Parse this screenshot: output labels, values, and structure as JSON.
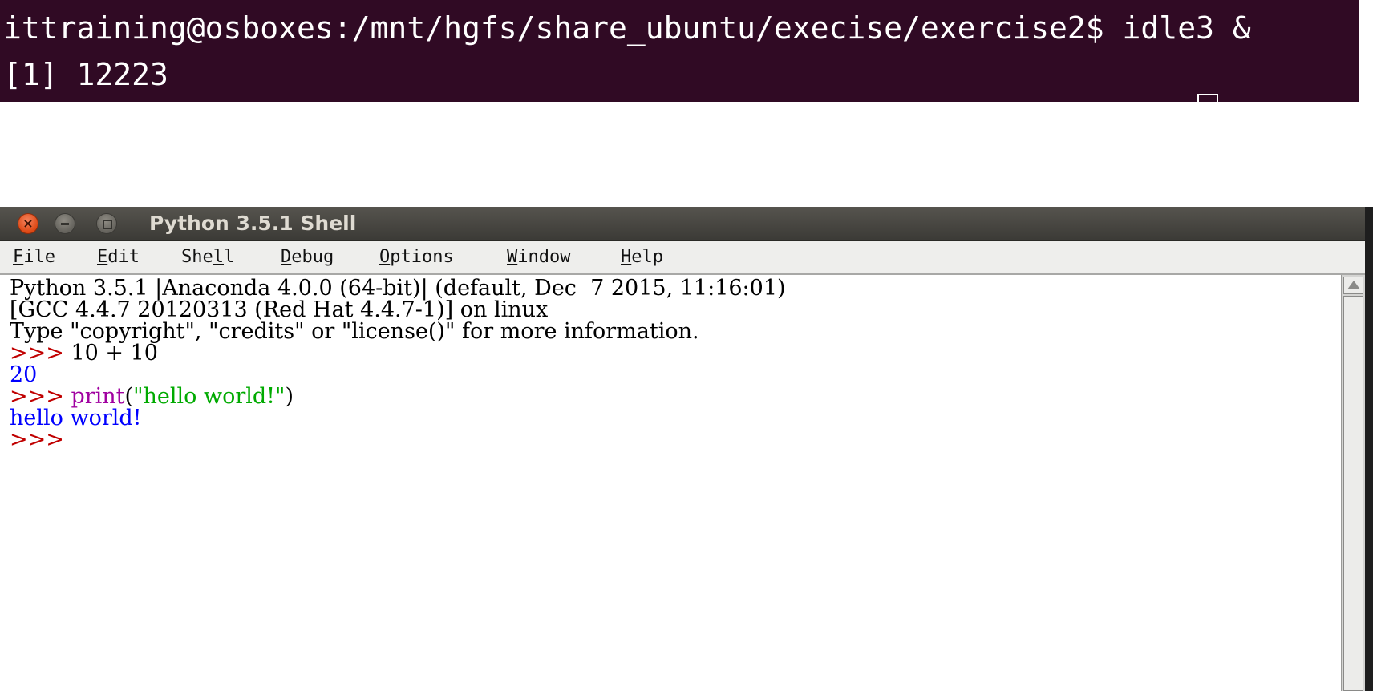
{
  "terminal": {
    "lines": [
      "ittraining@osboxes:/mnt/hgfs/share_ubuntu/execise/exercise2$ idle3 &",
      "[1] 12223"
    ],
    "background": "#300a24"
  },
  "window": {
    "title": "Python 3.5.1 Shell",
    "close_glyph": "×",
    "menu": [
      {
        "key": "F",
        "rest": "ile"
      },
      {
        "key": "E",
        "rest": "dit"
      },
      {
        "pre": "She",
        "key": "l",
        "rest": "l"
      },
      {
        "key": "D",
        "rest": "ebug"
      },
      {
        "key": "O",
        "rest": "ptions"
      },
      {
        "key": "W",
        "rest": "indow"
      },
      {
        "key": "H",
        "rest": "elp"
      }
    ]
  },
  "shell": {
    "banner": [
      "Python 3.5.1 |Anaconda 4.0.0 (64-bit)| (default, Dec  7 2015, 11:16:01)",
      "[GCC 4.4.7 20120313 (Red Hat 4.4.7-1)] on linux",
      "Type \"copyright\", \"credits\" or \"license()\" for more information."
    ],
    "prompt": ">>>",
    "cmd1": " 10 + 10",
    "out1": "20",
    "cmd2_kw": "print",
    "cmd2_open": "(",
    "cmd2_str": "\"hello world!\"",
    "cmd2_close": ")",
    "out2": "hello world!"
  },
  "colors": {
    "prompt": "#c00000",
    "output": "#0000ff",
    "keyword": "#a000a0",
    "string": "#00aa00"
  },
  "icons": [
    "close-icon",
    "minimize-icon",
    "maximize-icon",
    "scroll-up-arrow-icon"
  ]
}
